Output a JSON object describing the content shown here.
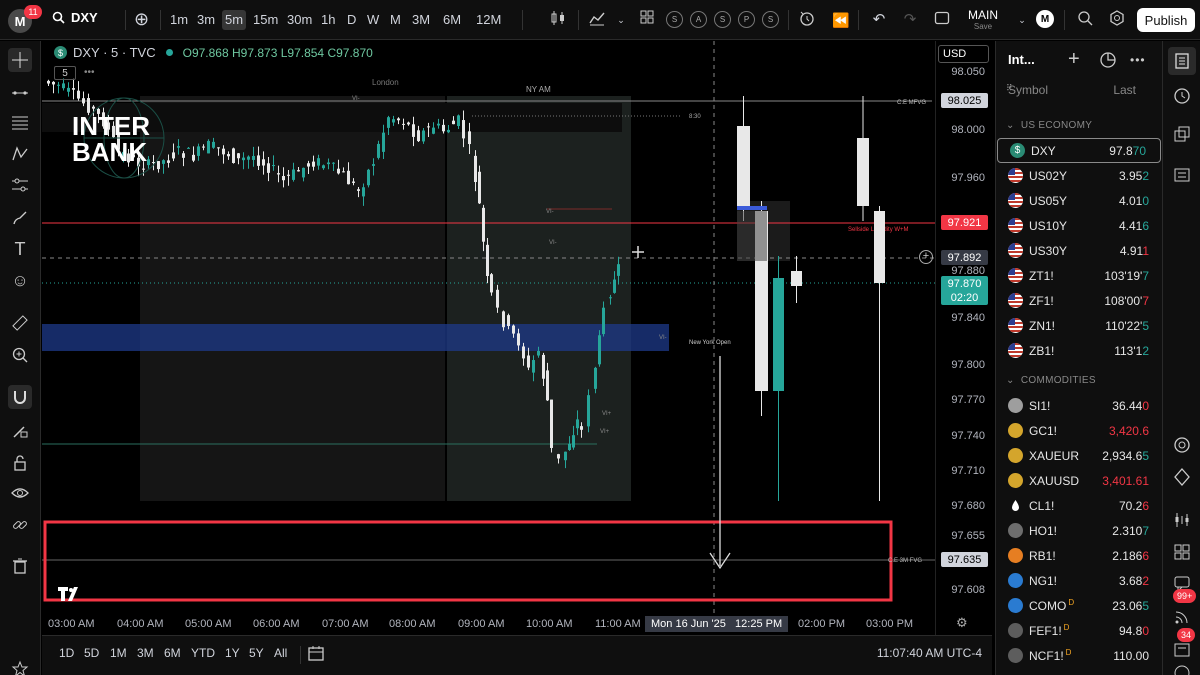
{
  "topbar": {
    "avatar_letter": "M",
    "notifications": "11",
    "symbol": "DXY",
    "intervals": [
      "1m",
      "3m",
      "5m",
      "15m",
      "30m",
      "1h",
      "D",
      "W",
      "M",
      "3M",
      "6M",
      "12M"
    ],
    "active_interval": "5m",
    "replay_buttons": [
      "S",
      "A",
      "S",
      "P",
      "S"
    ],
    "layout_name": "MAIN",
    "layout_status": "Save",
    "user_initial": "M",
    "publish_label": "Publish"
  },
  "legend": {
    "symbol_line": "DXY · 5 · TVC",
    "open": "O97.868",
    "high": "H97.873",
    "low": "L97.854",
    "close": "C97.870",
    "interval_pill": "5"
  },
  "watermark": {
    "line1": "INTER",
    "line2": "BANK"
  },
  "price_axis": {
    "currency": "USD",
    "ticks": [
      "98.050",
      "98.000",
      "97.960",
      "97.880",
      "97.840",
      "97.800",
      "97.770",
      "97.740",
      "97.710",
      "97.680",
      "97.655",
      "97.608"
    ],
    "tags": {
      "mfvg": "98.025",
      "liquidity": "97.921",
      "crosshair": "97.892",
      "last_price": "97.870",
      "countdown": "02:20",
      "fvg3m": "97.635"
    }
  },
  "annotations": {
    "london": "London",
    "ny_am": "NY AM",
    "time_830": "8:30",
    "ce_mfvg": "C.E MFVG",
    "sellside": "Sellside Liquidity  W+M",
    "ny_open": "New York Open",
    "ce_fvg": "C.E 3M FVG",
    "vi": "VI-",
    "vi_plus": "VI+"
  },
  "time_axis": {
    "labels": [
      "03:00 AM",
      "04:00 AM",
      "05:00 AM",
      "06:00 AM",
      "07:00 AM",
      "08:00 AM",
      "09:00 AM",
      "10:00 AM",
      "11:00 AM",
      "02:00 PM",
      "03:00 PM"
    ],
    "crosshair_date": "Mon 16 Jun '25",
    "crosshair_time": "12:25 PM"
  },
  "bottombar": {
    "ranges": [
      "1D",
      "5D",
      "1M",
      "3M",
      "6M",
      "YTD",
      "1Y",
      "5Y",
      "All"
    ],
    "clock": "11:07:40 AM UTC-4"
  },
  "watchlist": {
    "title": "Int...",
    "col_symbol": "Symbol",
    "col_last": "Last",
    "section_us": "US ECONOMY",
    "section_commod": "COMMODITIES",
    "us_rows": [
      {
        "sym": "DXY",
        "main": "97.8",
        "tail": "70",
        "dir": "up"
      },
      {
        "sym": "US02Y",
        "main": "3.95",
        "tail": "2",
        "dir": "up"
      },
      {
        "sym": "US05Y",
        "main": "4.01",
        "tail": "0",
        "dir": "up"
      },
      {
        "sym": "US10Y",
        "main": "4.41",
        "tail": "6",
        "dir": "up"
      },
      {
        "sym": "US30Y",
        "main": "4.91",
        "tail": "1",
        "dir": "dn"
      },
      {
        "sym": "ZT1!",
        "main": "103'19'",
        "tail": "7",
        "dir": "up"
      },
      {
        "sym": "ZF1!",
        "main": "108'00'",
        "tail": "7",
        "dir": "dn"
      },
      {
        "sym": "ZN1!",
        "main": "110'22'",
        "tail": "5",
        "dir": "up"
      },
      {
        "sym": "ZB1!",
        "main": "113'1",
        "tail": "2",
        "dir": "up"
      }
    ],
    "commod_rows": [
      {
        "sym": "SI1!",
        "main": "36.44",
        "tail": "0",
        "dir": "dn",
        "badge": ""
      },
      {
        "sym": "GC1!",
        "main": "3,420.6",
        "tail": "",
        "dir": "red",
        "badge": ""
      },
      {
        "sym": "XAUEUR",
        "main": "2,934.6",
        "tail": "5",
        "dir": "up",
        "badge": ""
      },
      {
        "sym": "XAUUSD",
        "main": "3,401.61",
        "tail": "",
        "dir": "red",
        "badge": ""
      },
      {
        "sym": "CL1!",
        "main": "70.2",
        "tail": "6",
        "dir": "dn",
        "badge": ""
      },
      {
        "sym": "HO1!",
        "main": "2.310",
        "tail": "7",
        "dir": "up",
        "badge": ""
      },
      {
        "sym": "RB1!",
        "main": "2.186",
        "tail": "6",
        "dir": "dn",
        "badge": ""
      },
      {
        "sym": "NG1!",
        "main": "3.68",
        "tail": "2",
        "dir": "dn",
        "badge": ""
      },
      {
        "sym": "COMO",
        "main": "23.06",
        "tail": "5",
        "dir": "up",
        "badge": "D"
      },
      {
        "sym": "FEF1!",
        "main": "94.8",
        "tail": "0",
        "dir": "dn",
        "badge": "D"
      },
      {
        "sym": "NCF1!",
        "main": "110.00",
        "tail": "",
        "dir": "none",
        "badge": "D"
      }
    ]
  },
  "rightstrip": {
    "badge_99": "99+",
    "badge_34": "34"
  },
  "colors": {
    "bull": "#26a69a",
    "bear_candle": "#e8e8e8",
    "red_line": "#f23645",
    "fvg_blue": "#1e3a8a",
    "green_tag": "#26a69a"
  }
}
